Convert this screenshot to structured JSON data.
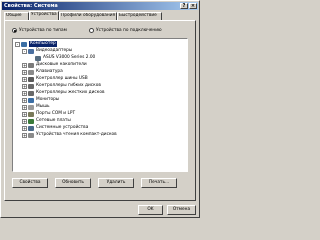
{
  "window": {
    "title": "Свойства: Система"
  },
  "tabs": [
    {
      "label": "Общие"
    },
    {
      "label": "Устройства"
    },
    {
      "label": "Профили оборудования"
    },
    {
      "label": "Быстродействие"
    }
  ],
  "view_options": {
    "by_type": "Устройства по типам",
    "by_connection": "Устройства по подключению",
    "selected": "by_type"
  },
  "tree": [
    {
      "label": "Компьютер",
      "level": 0,
      "toggle": "-",
      "icon": "computer-icon",
      "selected": true
    },
    {
      "label": "Видеоадаптеры",
      "level": 1,
      "toggle": "-",
      "icon": "monitor-icon"
    },
    {
      "label": "ASUS V3000 Series 2.00",
      "level": 2,
      "toggle": "",
      "icon": "display-adapter-icon"
    },
    {
      "label": "Дисковые накопители",
      "level": 1,
      "toggle": "+",
      "icon": "disk-drive-icon"
    },
    {
      "label": "Клавиатура",
      "level": 1,
      "toggle": "+",
      "icon": "keyboard-icon"
    },
    {
      "label": "Контроллер шины USB",
      "level": 1,
      "toggle": "+",
      "icon": "usb-icon"
    },
    {
      "label": "Контроллеры гибких дисков",
      "level": 1,
      "toggle": "+",
      "icon": "floppy-controller-icon"
    },
    {
      "label": "Контроллеры жестких дисков",
      "level": 1,
      "toggle": "+",
      "icon": "hdd-controller-icon"
    },
    {
      "label": "Мониторы",
      "level": 1,
      "toggle": "+",
      "icon": "monitor-icon"
    },
    {
      "label": "Мышь",
      "level": 1,
      "toggle": "+",
      "icon": "mouse-icon"
    },
    {
      "label": "Порты COM и LPT",
      "level": 1,
      "toggle": "+",
      "icon": "port-icon"
    },
    {
      "label": "Сетевые платы",
      "level": 1,
      "toggle": "+",
      "icon": "network-card-icon"
    },
    {
      "label": "Системные устройства",
      "level": 1,
      "toggle": "+",
      "icon": "system-device-icon"
    },
    {
      "label": "Устройства чтения компакт-дисков",
      "level": 1,
      "toggle": "+",
      "icon": "cdrom-icon"
    }
  ],
  "panel_buttons": {
    "properties": "Свойства",
    "refresh": "Обновить",
    "remove": "Удалить",
    "print": "Печать..."
  },
  "dialog_buttons": {
    "ok": "OK",
    "cancel": "Отмена"
  },
  "titlebar_buttons": {
    "help": "?",
    "close": "×"
  },
  "colors": {
    "titlebar_start": "#0a246a",
    "titlebar_end": "#a6caf0",
    "face": "#d4d0c8",
    "selection": "#0a246a"
  }
}
